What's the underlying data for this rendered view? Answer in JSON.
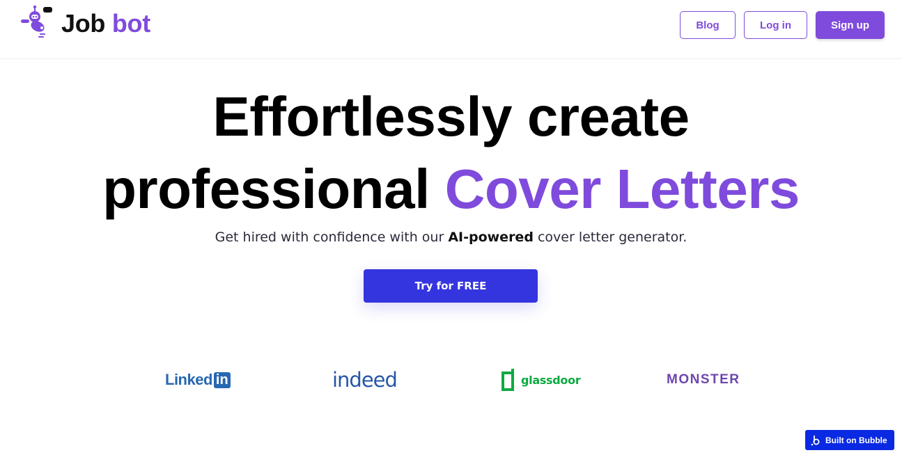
{
  "header": {
    "logo_job": "Job",
    "logo_bot": "bot",
    "nav": {
      "blog": "Blog",
      "login": "Log in",
      "signup": "Sign up"
    }
  },
  "hero": {
    "line1": "Effortlessly create",
    "line2_plain": "professional",
    "line2_accent": "Cover Letters",
    "subtitle_pre": "Get hired with confidence with our",
    "subtitle_bold": "AI-powered",
    "subtitle_post": "cover letter generator.",
    "cta": "Try for FREE"
  },
  "partners": {
    "linkedin_text": "Linked",
    "linkedin_box": "in",
    "indeed": "indeed",
    "glassdoor": "glassdoor",
    "monster": "MONSTER"
  },
  "badge": {
    "label": "Built on Bubble"
  },
  "colors": {
    "brand_purple": "#7f4bdc",
    "cta_blue": "#3535df",
    "bubble_blue": "#0a29e3",
    "linkedin": "#2867b2",
    "indeed": "#2557a7",
    "glassdoor": "#0caa41",
    "monster": "#6e46ae"
  },
  "icons": {
    "logo": "robot-icon",
    "glassdoor": "glassdoor-door-icon",
    "bubble": "bubble-b-icon"
  }
}
